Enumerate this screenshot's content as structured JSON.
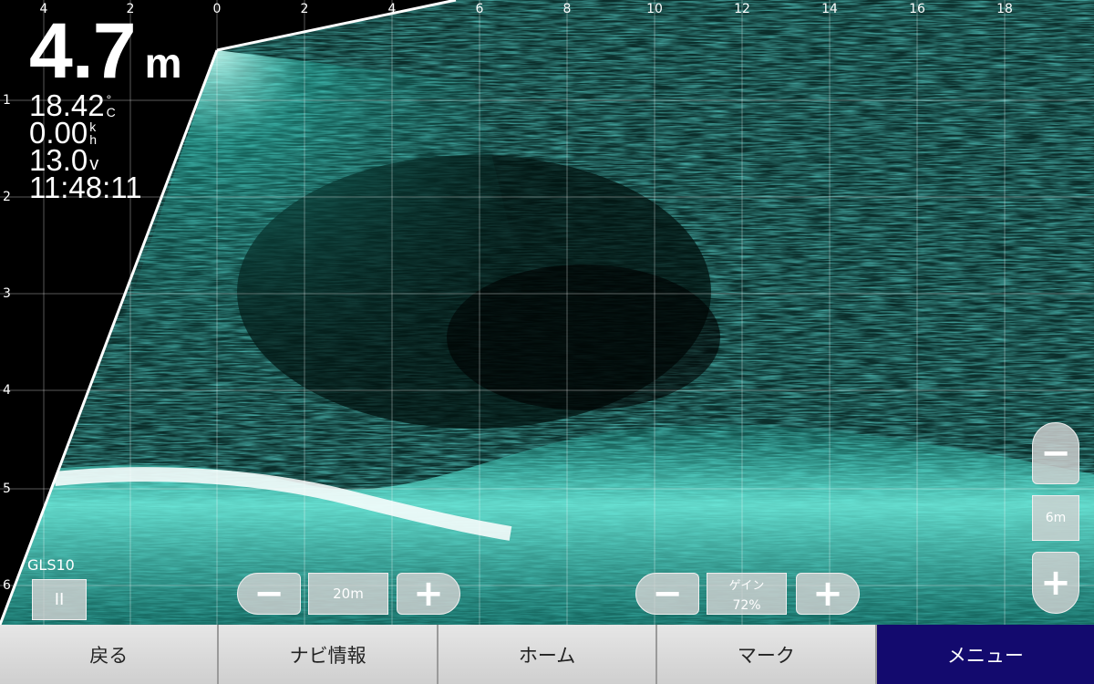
{
  "readouts": {
    "depth": {
      "value": "4.7",
      "unit": "m"
    },
    "water_temp": {
      "value": "18.42",
      "unit_top": "°",
      "unit_bottom": "C"
    },
    "speed": {
      "value": "0.00",
      "unit_top": "k",
      "unit_bottom": "h"
    },
    "voltage": {
      "value": "13.0",
      "unit": "v"
    },
    "time": "11:48:11"
  },
  "x_axis_ticks": [
    "4",
    "2",
    "0",
    "2",
    "4",
    "6",
    "8",
    "10",
    "12",
    "14",
    "16",
    "18"
  ],
  "y_axis_ticks": [
    "1",
    "2",
    "3",
    "4",
    "5",
    "6"
  ],
  "source": {
    "label": "GLS10",
    "pause_label": "II"
  },
  "range_control": {
    "minus": "−",
    "value": "20m",
    "plus": "+"
  },
  "gain_control": {
    "minus": "−",
    "title": "ゲイン",
    "value": "72%",
    "plus": "+"
  },
  "depth_zoom": {
    "minus": "−",
    "value": "6m",
    "plus": "+"
  },
  "nav": {
    "back": "戻る",
    "nav_info": "ナビ情報",
    "home": "ホーム",
    "mark": "マーク",
    "menu": "メニュー"
  },
  "colors": {
    "sonar_base": "#0a2a28",
    "sonar_echo": "#2fd6c4",
    "menu_active": "#130a6e"
  }
}
